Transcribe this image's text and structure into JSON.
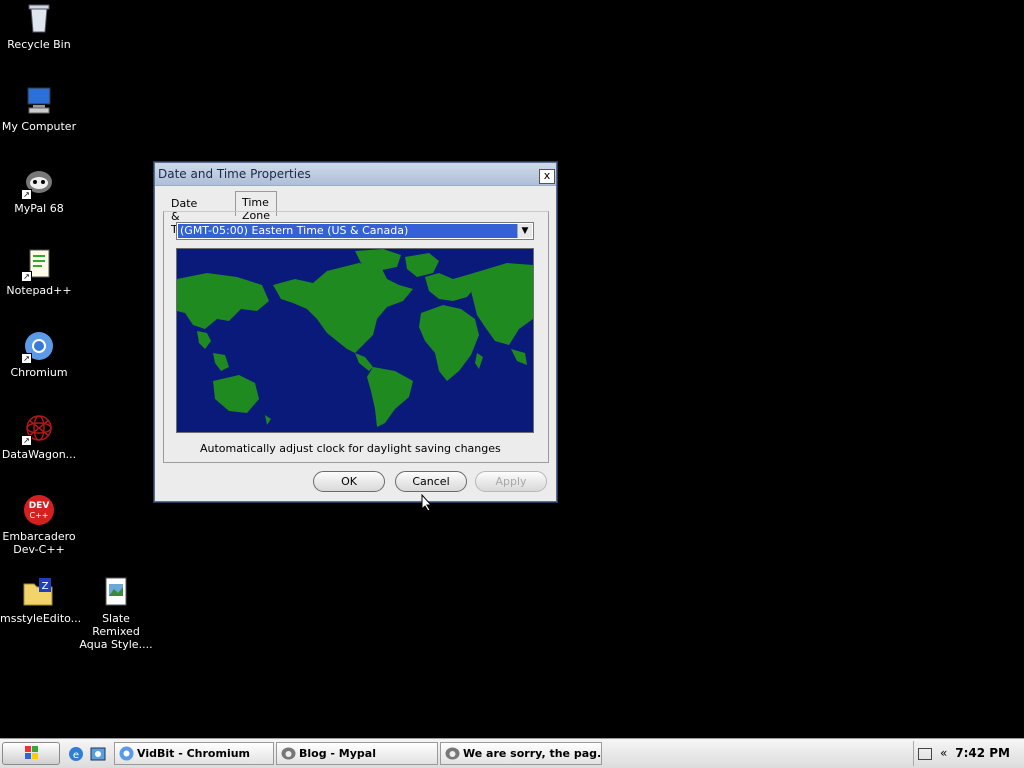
{
  "desktop": {
    "icons": [
      {
        "label": "Recycle Bin",
        "icon": "recycle-bin-icon"
      },
      {
        "label": "My Computer",
        "icon": "computer-icon"
      },
      {
        "label": "MyPal 68",
        "icon": "mypal-icon"
      },
      {
        "label": "Notepad++",
        "icon": "notepad-icon"
      },
      {
        "label": "Chromium",
        "icon": "chromium-icon"
      },
      {
        "label": "DataWagon...",
        "icon": "datawagon-icon"
      },
      {
        "label": "Embarcadero\nDev-C++",
        "icon": "devcpp-icon"
      },
      {
        "label": "msstyleEdito...",
        "icon": "folder-zip-icon"
      },
      {
        "label": "Slate Remixed\nAqua Style....",
        "icon": "document-icon"
      }
    ]
  },
  "dialog": {
    "title": "Date and Time Properties",
    "close": "x",
    "tabs": [
      "Date & Time",
      "Time Zone"
    ],
    "active_tab": "Time Zone",
    "timezone": "(GMT-05:00) Eastern Time (US & Canada)",
    "daylight_label": "Automatically adjust clock for daylight saving changes",
    "buttons": {
      "ok": "OK",
      "cancel": "Cancel",
      "apply": "Apply"
    }
  },
  "taskbar": {
    "tasks": [
      "VidBit - Chromium",
      "Blog - Mypal",
      "We are sorry, the pag..."
    ],
    "tray_chevron": "«",
    "clock": "7:42 PM"
  },
  "colors": {
    "map_ocean": "#0a1a7a",
    "map_land": "#1f8a1f",
    "selection": "#3462d4"
  }
}
